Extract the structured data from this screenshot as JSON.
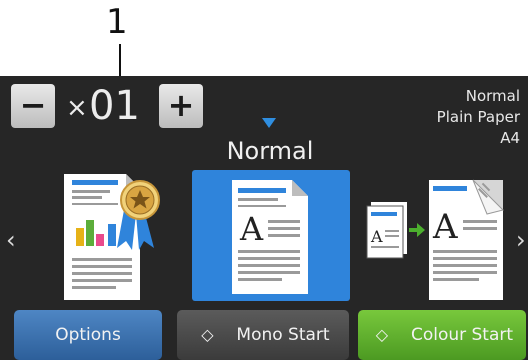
{
  "callout": {
    "label": "1"
  },
  "copies": {
    "minus_label": "−",
    "times_symbol": "×",
    "value": "01",
    "plus_label": "+"
  },
  "settings": {
    "quality": "Normal",
    "paper_type": "Plain Paper",
    "paper_size": "A4"
  },
  "mode": {
    "selected_label": "Normal",
    "items": [
      {
        "name": "quality",
        "icon": "quality-ribbon-document-icon"
      },
      {
        "name": "normal",
        "icon": "document-icon",
        "selected": true
      },
      {
        "name": "2-sided",
        "icon": "two-sided-copy-icon"
      }
    ],
    "selected_color": "#2f84db"
  },
  "nav": {
    "left": "‹",
    "right": "›"
  },
  "buttons": {
    "options": "Options",
    "mono_start": "Mono Start",
    "colour_start": "Colour Start",
    "start_icon": "◇"
  },
  "colors": {
    "screen_bg": "#262626",
    "options_btn": "#3d74b2",
    "mono_btn": "#4a4a4a",
    "colour_btn": "#62b22e",
    "accent": "#2f8ee0"
  }
}
